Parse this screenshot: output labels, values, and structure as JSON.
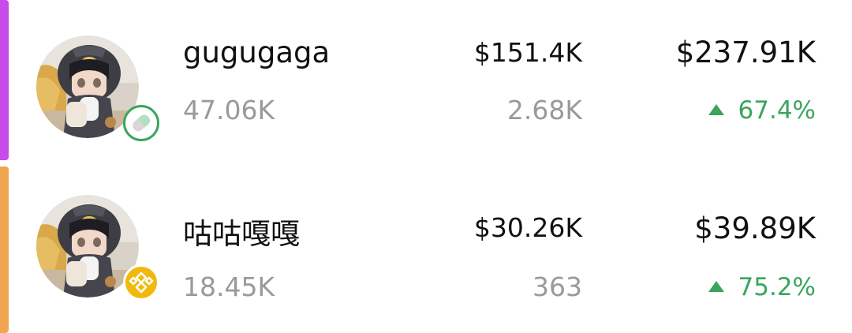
{
  "colors": {
    "row1_edge": "#c64be8",
    "row2_edge": "#f2a551",
    "positive": "#3aa55c",
    "primary_text": "#111111",
    "secondary_text": "#9a9a9a"
  },
  "rows": [
    {
      "name": "gugugaga",
      "followers": "47.06K",
      "middle_value": "$151.4K",
      "middle_sub": "2.68K",
      "total": "$237.91K",
      "change_icon": "triangle-up-icon",
      "change": "67.4%",
      "badge_icon": "pill-icon"
    },
    {
      "name": "咕咕嘎嘎",
      "followers": "18.45K",
      "middle_value": "$30.26K",
      "middle_sub": "363",
      "total": "$39.89K",
      "change_icon": "triangle-up-icon",
      "change": "75.2%",
      "badge_icon": "bnb-icon"
    }
  ]
}
